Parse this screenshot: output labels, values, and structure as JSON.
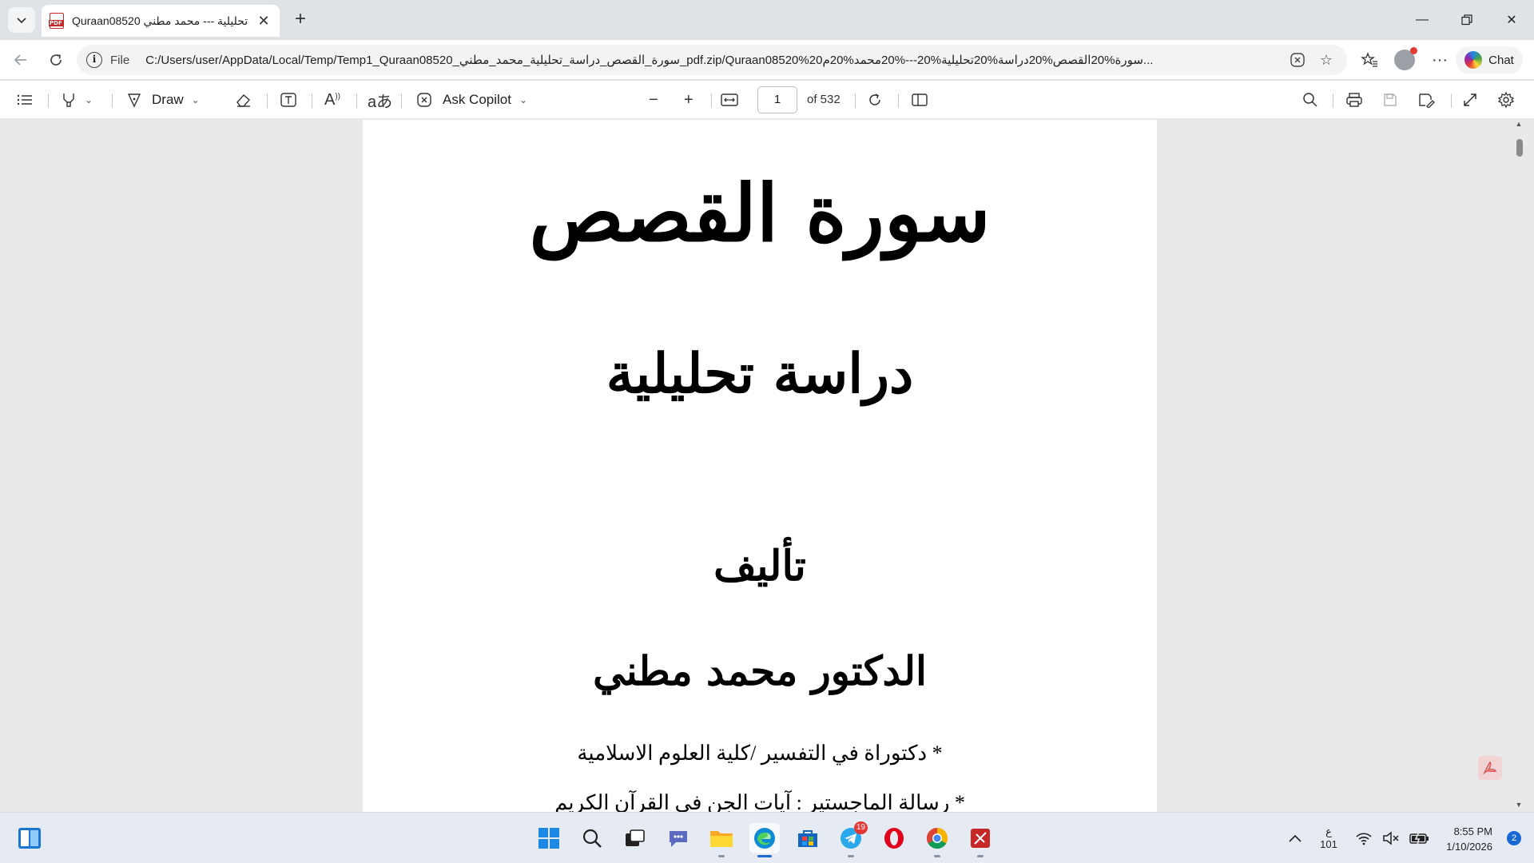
{
  "browser": {
    "tab": {
      "title": "Quraan08520 تحليلية --- محمد مطني"
    },
    "address_bar": {
      "scheme_label": "File",
      "url": "C:/Users/user/AppData/Local/Temp/Temp1_Quraan08520_سورة_القصص_دراسة_تحليلية_محمد_مطني_pdf.zip/Quraan08520%20سورة%20القصص%20دراسة%20تحليلية%20---%20محمد%20م..."
    },
    "chat_label": "Chat"
  },
  "pdf_toolbar": {
    "draw_label": "Draw",
    "copilot_label": "Ask Copilot",
    "page_current": "1",
    "page_total": "of 532"
  },
  "document": {
    "line1": "سورة القصص",
    "line2": "دراسة تحليلية",
    "line3": "تأليف",
    "line4": "الدكتور محمد مطني",
    "line5": "* دكتوراة في التفسير /كلية العلوم الاسلامية",
    "line6": "* رسالة الماجستير : آيات الجن في القرآن الكريم"
  },
  "taskbar": {
    "telegram_badge": "19",
    "input_indicator": "ع",
    "input_sub": "101",
    "time": "8:55 PM",
    "date": "1/10/2026",
    "notification_count": "2"
  },
  "colors": {
    "accent": "#1967d2",
    "tab_bg": "#dfe3e8",
    "doc_bg": "#e8e9eb",
    "alert_red": "#e53935"
  }
}
